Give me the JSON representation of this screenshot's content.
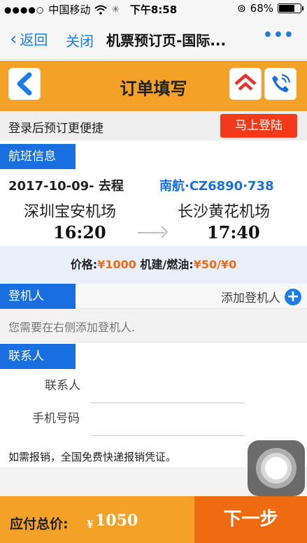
{
  "status_bar": {
    "carrier": "中国移动",
    "time": "下午8:58",
    "battery": "68%",
    "battery_level": 0.68
  },
  "nav": {
    "back_label": "返回",
    "close_label": "关闭",
    "title": "机票预订页-国际...",
    "more_label": "•••"
  },
  "header": {
    "title": "订单填写"
  },
  "login": {
    "hint": "登录后预订更便捷",
    "button_label": "马上登陆"
  },
  "flight": {
    "section_label": "航班信息",
    "date_label": "2017-10-09- 去程",
    "flight_code": "南航·CZ6890·738",
    "departure_airport": "深圳宝安机场",
    "arrival_airport": "长沙黄花机场",
    "departure_time": "16:20",
    "arrival_time": "17:40"
  },
  "price": {
    "price_label": "价格:",
    "price_value": "¥1000",
    "tax_label": " 机建/燃油:",
    "tax_value": "¥50/¥0"
  },
  "passenger": {
    "section_label": "登机人",
    "add_label": "添加登机人",
    "hint": "您需要在右侧添加登机人."
  },
  "contact": {
    "section_label": "联系人",
    "name_label": "联系人",
    "phone_label": "手机号码",
    "name_value": "",
    "phone_value": ""
  },
  "reimburse_note": "如需报销，全国免费快递报销凭证。",
  "bottom": {
    "total_label": "应付总价:",
    "currency": "¥",
    "total_value": "1050",
    "next_label": "下一步"
  },
  "colors": {
    "orange": "#f4a127",
    "blue": "#1a6fe0",
    "red": "#f23a1a",
    "next_orange": "#ef6b12"
  }
}
